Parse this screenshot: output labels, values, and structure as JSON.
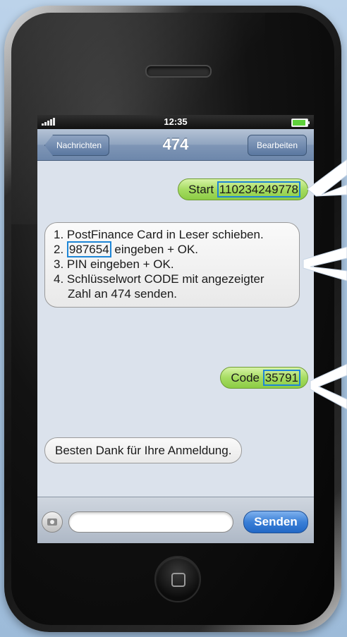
{
  "status_bar": {
    "time": "12:35"
  },
  "nav": {
    "back_label": "Nachrichten",
    "title": "474",
    "edit_label": "Bearbeiten"
  },
  "messages": [
    {
      "direction": "outgoing",
      "prefix": "Start",
      "highlight": "110234249778"
    },
    {
      "direction": "incoming",
      "line1": "1. PostFinance Card in Leser schieben.",
      "line2_prefix": "2.",
      "line2_highlight": "987654",
      "line2_suffix": "eingeben + OK.",
      "line3": "3. PIN eingeben + OK.",
      "line4": "4. Schlüsselwort CODE mit angezeigter",
      "line5": "Zahl an 474 senden."
    },
    {
      "direction": "outgoing",
      "prefix": "Code",
      "highlight": "35791"
    },
    {
      "direction": "incoming",
      "text": "Besten Dank für Ihre Anmeldung."
    }
  ],
  "composer": {
    "send_label": "Senden",
    "placeholder": "",
    "camera_icon": "camera-icon"
  },
  "colors": {
    "outgoing_bubble": "#a6dc62",
    "incoming_bubble": "#ededed",
    "highlight_border": "#1e86d6",
    "send_button": "#3a7fd7"
  }
}
